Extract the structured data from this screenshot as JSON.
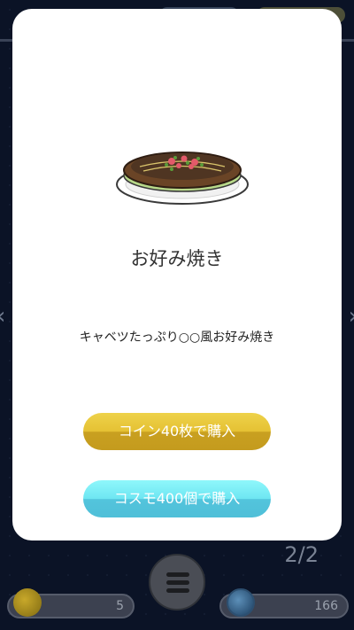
{
  "item": {
    "name": "お好み焼き",
    "description": "キャベツたっぷり○○風お好み焼き",
    "image_icon": "okonomiyaki-icon"
  },
  "buttons": {
    "buy_with_coins": "コイン40枚で購入",
    "buy_with_cosmo": "コスモ400個で購入"
  },
  "pagination": {
    "indicator": "2/2"
  },
  "currency": {
    "coins": "5",
    "cosmo": "166"
  },
  "icons": {
    "prev": "‹",
    "next": "›",
    "menu": "hamburger-menu-icon"
  },
  "colors": {
    "coin_button": "#e5c133",
    "cosmo_button": "#6ee6f2",
    "background": "#0b1326"
  }
}
